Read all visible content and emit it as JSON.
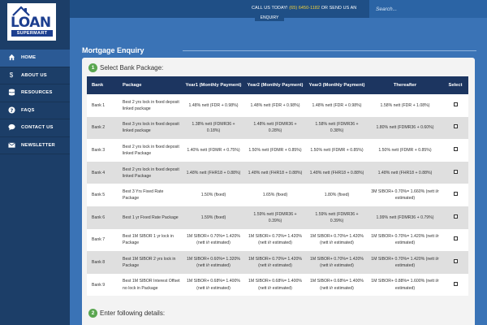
{
  "header": {
    "call_prefix": "CALL US TODAY! ",
    "phone": "(65) 6450-1182",
    "call_suffix": " OR SEND US AN",
    "enquiry_label": "ENQUIRY",
    "search_placeholder": "Search..."
  },
  "logo": {
    "word": "LOAN",
    "sub": "SUPERMART"
  },
  "sidebar": {
    "items": [
      {
        "label": "HOME",
        "icon": "home-icon",
        "active": true
      },
      {
        "label": "ABOUT US",
        "icon": "dollar-icon",
        "active": false
      },
      {
        "label": "RESOURCES",
        "icon": "database-icon",
        "active": false
      },
      {
        "label": "FAQS",
        "icon": "question-icon",
        "active": false
      },
      {
        "label": "CONTACT US",
        "icon": "chat-bubble-icon",
        "active": false
      },
      {
        "label": "NEWSLETTER",
        "icon": "envelope-icon",
        "active": false
      }
    ]
  },
  "page": {
    "title": "Mortgage Enquiry"
  },
  "step1": {
    "num": "1",
    "label": "Select Bank Package:"
  },
  "step2": {
    "num": "2",
    "label": "Enter following details:"
  },
  "table": {
    "headers": [
      "Bank",
      "Package",
      "Year1 (Monthly Payment)",
      "Year2 (Monthly Payment)",
      "Year3 (Monthly Payment)",
      "Thereafter",
      "Select"
    ],
    "rows": [
      [
        "Bank 1",
        "Best 2 yrs lock in fixed deposit linked package",
        "1.48% nett (FDR + 0.98%)",
        "1.48% nett (FDR + 0.98%)",
        "1.48% nett (FDR + 0.98%)",
        "1.58% nett (FDR + 1.08%)"
      ],
      [
        "Bank 2",
        "Best 3 yrs lock in fixed deposit linked package",
        "1.38% nett (FDMR36 + 0.18%)",
        "1.48% nett (FDMR36 + 0.28%)",
        "1.58% nett (FDMR36 + 0.38%)",
        "1.80% nett (FDMR36 + 0.60%)"
      ],
      [
        "Bank 3",
        "Best 2 yrs lock in fixed deposit linked Package",
        "1.40% nett (FDMR + 0.75%)",
        "1.50% nett (FDMR + 0.85%)",
        "1.50% nett (FDMR + 0.85%)",
        "1.50% nett (FDMR + 0.85%)"
      ],
      [
        "Bank 4",
        "Best 2 yrs lock in fixed deposit linked Package",
        "1.48% nett (FHR18 + 0.88%)",
        "1.48% nett (FHR18 + 0.88%)",
        "1.48% nett (FHR18 + 0.88%)",
        "1.48% nett (FHR18 + 0.88%)"
      ],
      [
        "Bank 5",
        "Best 3 Yrs Fixed Rate Package",
        "1.50% (fixed)",
        "1.65% (fixed)",
        "1.80% (fixed)",
        "3M SIBOR+ 0.70%= 1.660% (nett i/r estimated)"
      ],
      [
        "Bank 6",
        "Best 1 yr Fixed Rate Package",
        "1.59% (fixed)",
        "1.59% nett (FDMR36 + 0.39%)",
        "1.59% nett (FDMR36 + 0.39%)",
        "1.99% nett (FDMR36 + 0.79%)"
      ],
      [
        "Bank 7",
        "Best 1M SIBOR 1 yr lock in Package",
        "1M SIBOR+ 0.70%= 1.420% (nett i/r estimated)",
        "1M SIBOR+ 0.70%= 1.420% (nett i/r estimated)",
        "1M SIBOR+ 0.70%= 1.420% (nett i/r estimated)",
        "1M SIBOR+ 0.70%= 1.420% (nett i/r estimated)"
      ],
      [
        "Bank 8",
        "Best 1M SIBOR 2 yrs lock in Package",
        "1M SIBOR+ 0.60%= 1.320% (nett i/r estimated)",
        "1M SIBOR+ 0.70%= 1.420% (nett i/r estimated)",
        "1M SIBOR+ 0.70%= 1.420% (nett i/r estimated)",
        "1M SIBOR+ 0.70%= 1.420% (nett i/r estimated)"
      ],
      [
        "Bank 9",
        "Best 1M SIBOR Interest Offset no lock in Package",
        "1M SIBOR+ 0.68%= 1.400% (nett i/r estimated)",
        "1M SIBOR+ 0.68%= 1.400% (nett i/r estimated)",
        "1M SIBOR+ 0.68%= 1.400% (nett i/r estimated)",
        "1M SIBOR+ 0.88%= 1.600% (nett i/r estimated)"
      ]
    ]
  },
  "colors": {
    "accent": "#3a73b6",
    "sidebar": "#1c3e68",
    "header_row": "#1c3560",
    "step": "#5aa650",
    "phone": "#f3d23a"
  }
}
